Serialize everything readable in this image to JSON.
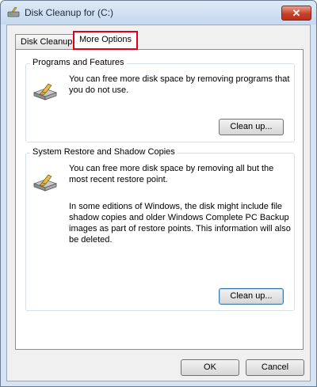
{
  "window": {
    "title": "Disk Cleanup for  (C:)",
    "close_glyph": "✕"
  },
  "tabs": [
    {
      "label": "Disk Cleanup"
    },
    {
      "label": "More Options"
    }
  ],
  "groups": [
    {
      "title": "Programs and Features",
      "text": "You can free more disk space by removing programs that you do not use.",
      "button": "Clean up..."
    },
    {
      "title": "System Restore and Shadow Copies",
      "text": "You can free more disk space by removing all but the most recent restore point.",
      "text2": "In some editions of Windows, the disk might include file shadow copies and older Windows Complete PC Backup images as part of restore points. This information will also be deleted.",
      "button": "Clean up..."
    }
  ],
  "footer": {
    "ok": "OK",
    "cancel": "Cancel"
  },
  "colors": {
    "highlight": "#e1001a",
    "titlebar": "#c6d8ee"
  },
  "icons": [
    "disk-cleanup-icon",
    "close-icon",
    "drive-icon"
  ]
}
